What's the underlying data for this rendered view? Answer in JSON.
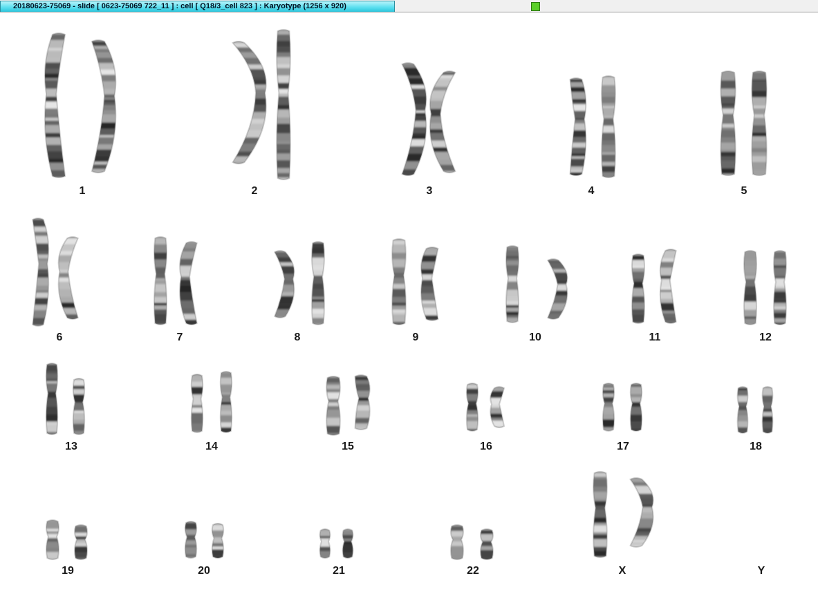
{
  "window": {
    "title": "20180623-75069 - slide [ 0623-75069 722_11 ] : cell [ Q18/3_cell 823 ] : Karyotype  (1256 x 920)",
    "status_color": "#5ccf2a"
  },
  "karyotype": {
    "chromosomes": [
      {
        "label": "1"
      },
      {
        "label": "2"
      },
      {
        "label": "3"
      },
      {
        "label": "4"
      },
      {
        "label": "5"
      },
      {
        "label": "6"
      },
      {
        "label": "7"
      },
      {
        "label": "8"
      },
      {
        "label": "9"
      },
      {
        "label": "10"
      },
      {
        "label": "11"
      },
      {
        "label": "12"
      },
      {
        "label": "13"
      },
      {
        "label": "14"
      },
      {
        "label": "15"
      },
      {
        "label": "16"
      },
      {
        "label": "17"
      },
      {
        "label": "18"
      },
      {
        "label": "19"
      },
      {
        "label": "20"
      },
      {
        "label": "21"
      },
      {
        "label": "22"
      },
      {
        "label": "X"
      },
      {
        "label": "Y"
      }
    ]
  }
}
